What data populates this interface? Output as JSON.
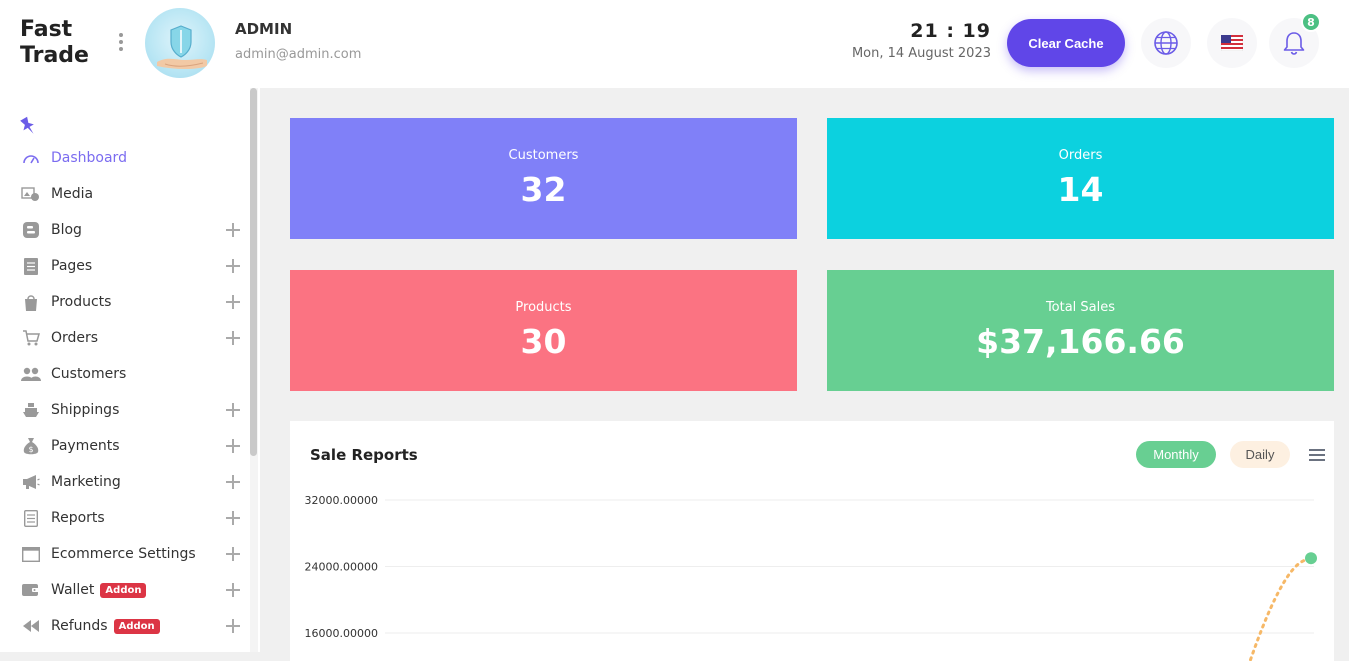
{
  "brand": {
    "line1": "Fast",
    "line2": "Trade"
  },
  "user": {
    "name": "ADMIN",
    "email": "admin@admin.com"
  },
  "clock": {
    "time": "21 : 19",
    "date": "Mon, 14 August 2023"
  },
  "header": {
    "clear_cache_label": "Clear Cache",
    "notification_count": "8",
    "icons": [
      "globe-icon",
      "us-flag-icon",
      "bell-icon"
    ]
  },
  "sidebar": {
    "items": [
      {
        "label": "Dashboard",
        "icon": "dashboard-gauge-icon",
        "active": true,
        "expandable": false
      },
      {
        "label": "Media",
        "icon": "media-icon",
        "active": false,
        "expandable": false
      },
      {
        "label": "Blog",
        "icon": "blog-icon",
        "active": false,
        "expandable": true
      },
      {
        "label": "Pages",
        "icon": "pages-icon",
        "active": false,
        "expandable": true
      },
      {
        "label": "Products",
        "icon": "products-icon",
        "active": false,
        "expandable": true
      },
      {
        "label": "Orders",
        "icon": "cart-icon",
        "active": false,
        "expandable": true
      },
      {
        "label": "Customers",
        "icon": "users-icon",
        "active": false,
        "expandable": false
      },
      {
        "label": "Shippings",
        "icon": "ship-icon",
        "active": false,
        "expandable": true
      },
      {
        "label": "Payments",
        "icon": "money-bag-icon",
        "active": false,
        "expandable": true
      },
      {
        "label": "Marketing",
        "icon": "megaphone-icon",
        "active": false,
        "expandable": true
      },
      {
        "label": "Reports",
        "icon": "report-icon",
        "active": false,
        "expandable": true
      },
      {
        "label": "Ecommerce Settings",
        "icon": "window-icon",
        "active": false,
        "expandable": true
      },
      {
        "label": "Wallet",
        "icon": "wallet-icon",
        "active": false,
        "expandable": true,
        "badge": "Addon"
      },
      {
        "label": "Refunds",
        "icon": "rewind-icon",
        "active": false,
        "expandable": true,
        "badge": "Addon"
      }
    ]
  },
  "stats": [
    {
      "label": "Customers",
      "value": "32",
      "color": "#8080f8"
    },
    {
      "label": "Orders",
      "value": "14",
      "color": "#0cd1df"
    },
    {
      "label": "Products",
      "value": "30",
      "color": "#fb7382"
    },
    {
      "label": "Total Sales",
      "value": "$37,166.66",
      "color": "#67cf92"
    }
  ],
  "report": {
    "title": "Sale Reports",
    "monthly_label": "Monthly",
    "daily_label": "Daily"
  },
  "chart_data": {
    "type": "line",
    "y_ticks": [
      "32000.00000",
      "24000.00000",
      "16000.00000"
    ],
    "visible_point": {
      "y": 25000
    },
    "ylim": [
      16000,
      32000
    ],
    "line_style": "dotted",
    "line_color": "#f6b867",
    "point_color": "#67cf92"
  }
}
